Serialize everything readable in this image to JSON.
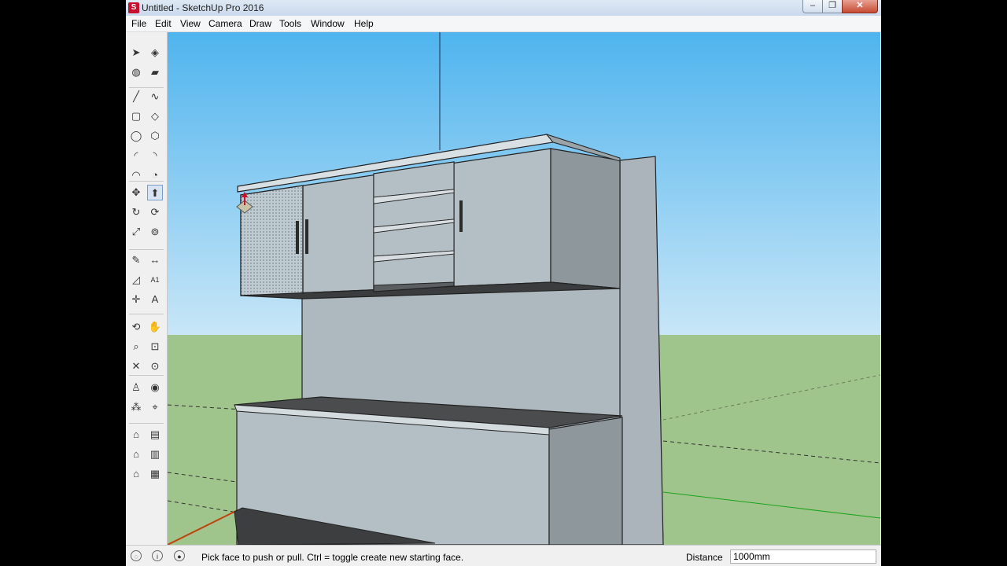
{
  "window": {
    "title": "Untitled - SketchUp Pro 2016",
    "minimize_glyph": "‒",
    "maximize_glyph": "❐",
    "close_glyph": "✕"
  },
  "menu": [
    "File",
    "Edit",
    "View",
    "Camera",
    "Draw",
    "Tools",
    "Window",
    "Help"
  ],
  "toolbar": [
    {
      "name": "select",
      "glyph": "➤"
    },
    {
      "name": "make-component",
      "glyph": "◈"
    },
    {
      "name": "paint-bucket",
      "glyph": "◍"
    },
    {
      "name": "eraser",
      "glyph": "▰"
    },
    {
      "name": "line",
      "glyph": "╱"
    },
    {
      "name": "freehand",
      "glyph": "∿"
    },
    {
      "name": "rectangle",
      "glyph": "▢"
    },
    {
      "name": "rotated-rectangle",
      "glyph": "◇"
    },
    {
      "name": "circle",
      "glyph": "◯"
    },
    {
      "name": "polygon",
      "glyph": "⬡"
    },
    {
      "name": "arc",
      "glyph": "◜"
    },
    {
      "name": "2-point-arc",
      "glyph": "◝"
    },
    {
      "name": "3-point-arc",
      "glyph": "◠"
    },
    {
      "name": "pie",
      "glyph": "◔"
    },
    {
      "name": "move",
      "glyph": "✥"
    },
    {
      "name": "push-pull",
      "glyph": "⬆"
    },
    {
      "name": "rotate",
      "glyph": "↻"
    },
    {
      "name": "follow-me",
      "glyph": "⟳"
    },
    {
      "name": "scale",
      "glyph": "⤢"
    },
    {
      "name": "offset",
      "glyph": "⊚"
    },
    {
      "name": "tape-measure",
      "glyph": "✎"
    },
    {
      "name": "dimension",
      "glyph": "↔"
    },
    {
      "name": "protractor",
      "glyph": "◿"
    },
    {
      "name": "text",
      "glyph": "A1"
    },
    {
      "name": "axes",
      "glyph": "✛"
    },
    {
      "name": "3d-text",
      "glyph": "A"
    },
    {
      "name": "orbit",
      "glyph": "⟲"
    },
    {
      "name": "pan",
      "glyph": "✋"
    },
    {
      "name": "zoom",
      "glyph": "⌕"
    },
    {
      "name": "zoom-window",
      "glyph": "⊡"
    },
    {
      "name": "zoom-extents",
      "glyph": "✕"
    },
    {
      "name": "previous",
      "glyph": "⊙"
    },
    {
      "name": "position-camera",
      "glyph": "♙"
    },
    {
      "name": "look-around",
      "glyph": "◉"
    },
    {
      "name": "walk",
      "glyph": "⁂"
    },
    {
      "name": "section-plane",
      "glyph": "⌖"
    },
    {
      "name": "iso-view",
      "glyph": "⌂"
    },
    {
      "name": "top-view",
      "glyph": "▤"
    },
    {
      "name": "front-view",
      "glyph": "⌂"
    },
    {
      "name": "right-view",
      "glyph": "▥"
    },
    {
      "name": "back-view",
      "glyph": "⌂"
    },
    {
      "name": "left-view",
      "glyph": "▦"
    }
  ],
  "status": {
    "text": "Pick face to push or pull.  Ctrl = toggle create new starting face.",
    "measure_label": "Distance",
    "measure_value": "1000mm",
    "icons": [
      "geo-location-icon",
      "credits-icon",
      "user-icon"
    ]
  },
  "colors": {
    "sky_top": "#4fb4ee",
    "sky_bottom": "#c8e6f7",
    "ground": "#a0c58c",
    "cabinet_front": "#b4bfc5",
    "cabinet_side": "#8d979c",
    "countertop": "#4a4c4e"
  }
}
